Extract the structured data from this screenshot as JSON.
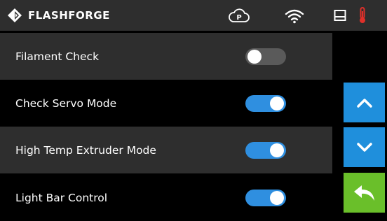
{
  "header": {
    "brand": "FLASHFORGE",
    "icons": [
      "flashforge-logo-icon",
      "cloud-p-icon",
      "wifi-icon",
      "printer-icon",
      "thermometer-icon"
    ],
    "accent_temp_color": "#e0302a"
  },
  "settings": [
    {
      "label": "Filament Check",
      "state": "off"
    },
    {
      "label": "Check Servo Mode",
      "state": "on"
    },
    {
      "label": "High Temp Extruder Mode",
      "state": "on"
    },
    {
      "label": "Light Bar Control",
      "state": "on"
    }
  ],
  "nav": {
    "up_icon": "chevron-up-icon",
    "down_icon": "chevron-down-icon",
    "back_icon": "back-arrow-icon"
  },
  "colors": {
    "toggle_on": "#2f8fe0",
    "toggle_off": "#5a5a5a",
    "nav_blue": "#1f8fdc",
    "back_green": "#6abf2a"
  }
}
